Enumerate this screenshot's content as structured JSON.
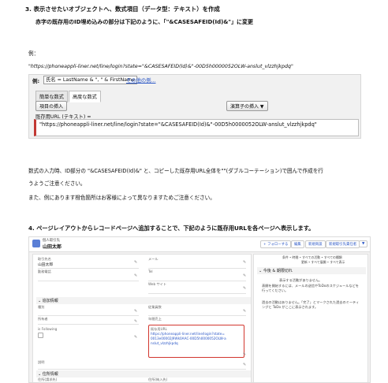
{
  "step3": {
    "heading": "3. 表示させたいオブジェクトへ、数式項目（データ型：テキスト）を作成",
    "subheading": "赤字の既存用のID埋め込みの部分は下記のように、「\"&CASESAFEID(Id)&\"」に変更",
    "example_label": "例：",
    "example_url": "\"https://phoneappli-liner.net/line/login?state=\"&CASESAFEID(Id)&\"-00D5h0000052OLW-anslut_vlzzhjkpdq\""
  },
  "formula_editor": {
    "ex_label": "例:",
    "ex_formula": "氏名 = LastName & \", \" & FirstName",
    "other_examples": "その他の例...",
    "tabs": [
      "簡単な数式",
      "高度な数式"
    ],
    "insert_field": "項目の挿入",
    "insert_operator": "演算子の挿入 ▼",
    "field_label": "既存用URL (テキスト) =",
    "formula": "\"https://phoneappli-liner.net/line/login?state=\"&CASESAFEID(Id)&\"-00D5h0000052OLW-anslut_vlzzhjkpdq\""
  },
  "notes": {
    "line1": "数式の入力時、ID部分の \"&CASESAFEID(Id)&\" と、コピーした既存用URL全体を\"\"(ダブルコーテーション)で囲んで作成を行",
    "line2": "うようご注意ください。",
    "line3": "また、例にあります橙色箇所はお客様によって異なりますためご注意ください。"
  },
  "step4": {
    "heading": "4. ページレイアウトからレコードページへ追加することで、下記のように既存用URLを各ページへ表示します。"
  },
  "record_page": {
    "record_type": "個人取引先",
    "record_name": "山田太郎",
    "header_buttons": [
      "+ フォローする",
      "編集",
      "新規商談",
      "新規取引先責任者",
      "▼"
    ],
    "left": {
      "name_label": "取引先名",
      "name_value": "山田太郎",
      "mail_label": "メール",
      "phone_label": "Tel",
      "fax_label": "勤務電話",
      "web_label": "Web サイト",
      "section_extra": "追加情報",
      "f1": "種別",
      "f2": "従業員数",
      "f3": "所有者",
      "f4": "年間売上",
      "following_label": "is Following",
      "url_label": "既存用URL",
      "url_value": "https://phoneappli-liner.net/line/login?state=0013e00002J9Wk0AAC-00D5h0000052OLW-anslut_vlzzhjkpdq",
      "desc_label": "説明",
      "section_address": "住所情報",
      "addr1": "住所(請求先)",
      "addr2": "住所(納入先)"
    },
    "side": {
      "filter": "条件 • 時間 • すべての活動 • すべての種類",
      "links": "更新 • すべて展開 • すべて表示",
      "section": "今後 & 期限切れ",
      "msg1": "表示する活動がありません。",
      "msg2": "表開を開始するには、メールの送信やToDoのスケジュールなどを行ってください。",
      "msg3": "過去の活動はありません。「完了」とマークされた過去のミーティングと ToDo がここに表示されます。"
    }
  }
}
